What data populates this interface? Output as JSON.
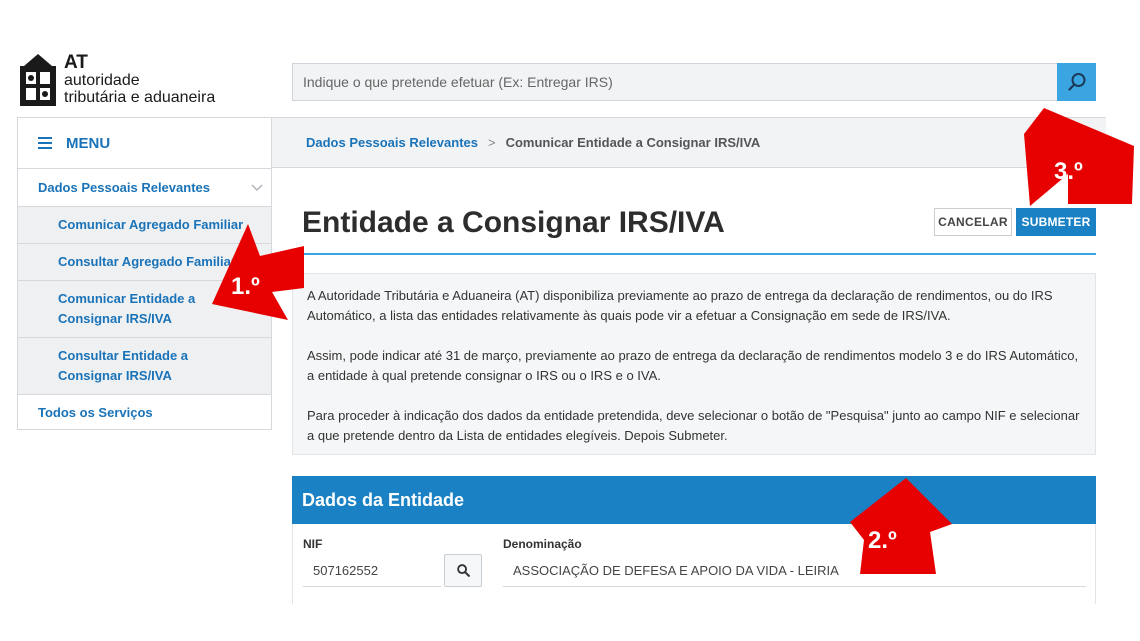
{
  "logo": {
    "line1": "AT",
    "line2": "autoridade",
    "line3": "tributária e aduaneira"
  },
  "search": {
    "placeholder": "Indique o que pretende efetuar (Ex: Entregar IRS)",
    "icon": "search-icon"
  },
  "sidebar": {
    "menu_label": "MENU",
    "section_label": "Dados Pessoais Relevantes",
    "items": [
      {
        "label": "Comunicar Agregado Familiar"
      },
      {
        "label": "Consultar Agregado Familiar"
      },
      {
        "label": "Comunicar Entidade a Consignar IRS/IVA"
      },
      {
        "label": "Consultar Entidade a Consignar IRS/IVA"
      }
    ],
    "all_services": "Todos os Serviços"
  },
  "breadcrumb": {
    "parent": "Dados Pessoais Relevantes",
    "separator": ">",
    "current": "Comunicar Entidade a Consignar IRS/IVA"
  },
  "page": {
    "title": "Entidade a Consignar IRS/IVA",
    "cancel_label": "CANCELAR",
    "submit_label": "SUBMETER"
  },
  "info": {
    "p1": "A Autoridade Tributária e Aduaneira (AT) disponibiliza previamente ao prazo de entrega da declaração de rendimentos, ou do IRS Automático, a lista das entidades relativamente às quais pode vir a efetuar a Consignação em sede de IRS/IVA.",
    "p2": "Assim, pode indicar até 31 de março, previamente ao prazo de entrega da declaração de rendimentos modelo 3 e do IRS Automático, a entidade à qual pretende consignar o IRS ou o IRS e o IVA.",
    "p3": "Para proceder à indicação dos dados da entidade pretendida, deve selecionar o botão de \"Pesquisa\" junto ao campo NIF e selecionar a que pretende dentro da Lista de entidades elegíveis. Depois Submeter."
  },
  "entity": {
    "heading": "Dados da Entidade",
    "nif_label": "NIF",
    "nif_value": "507162552",
    "name_label": "Denominação",
    "name_value": "ASSOCIAÇÃO DE DEFESA E APOIO DA VIDA - LEIRIA"
  },
  "annotations": {
    "step1": "1.º",
    "step2": "2.º",
    "step3": "3.º",
    "color": "#e60000"
  }
}
